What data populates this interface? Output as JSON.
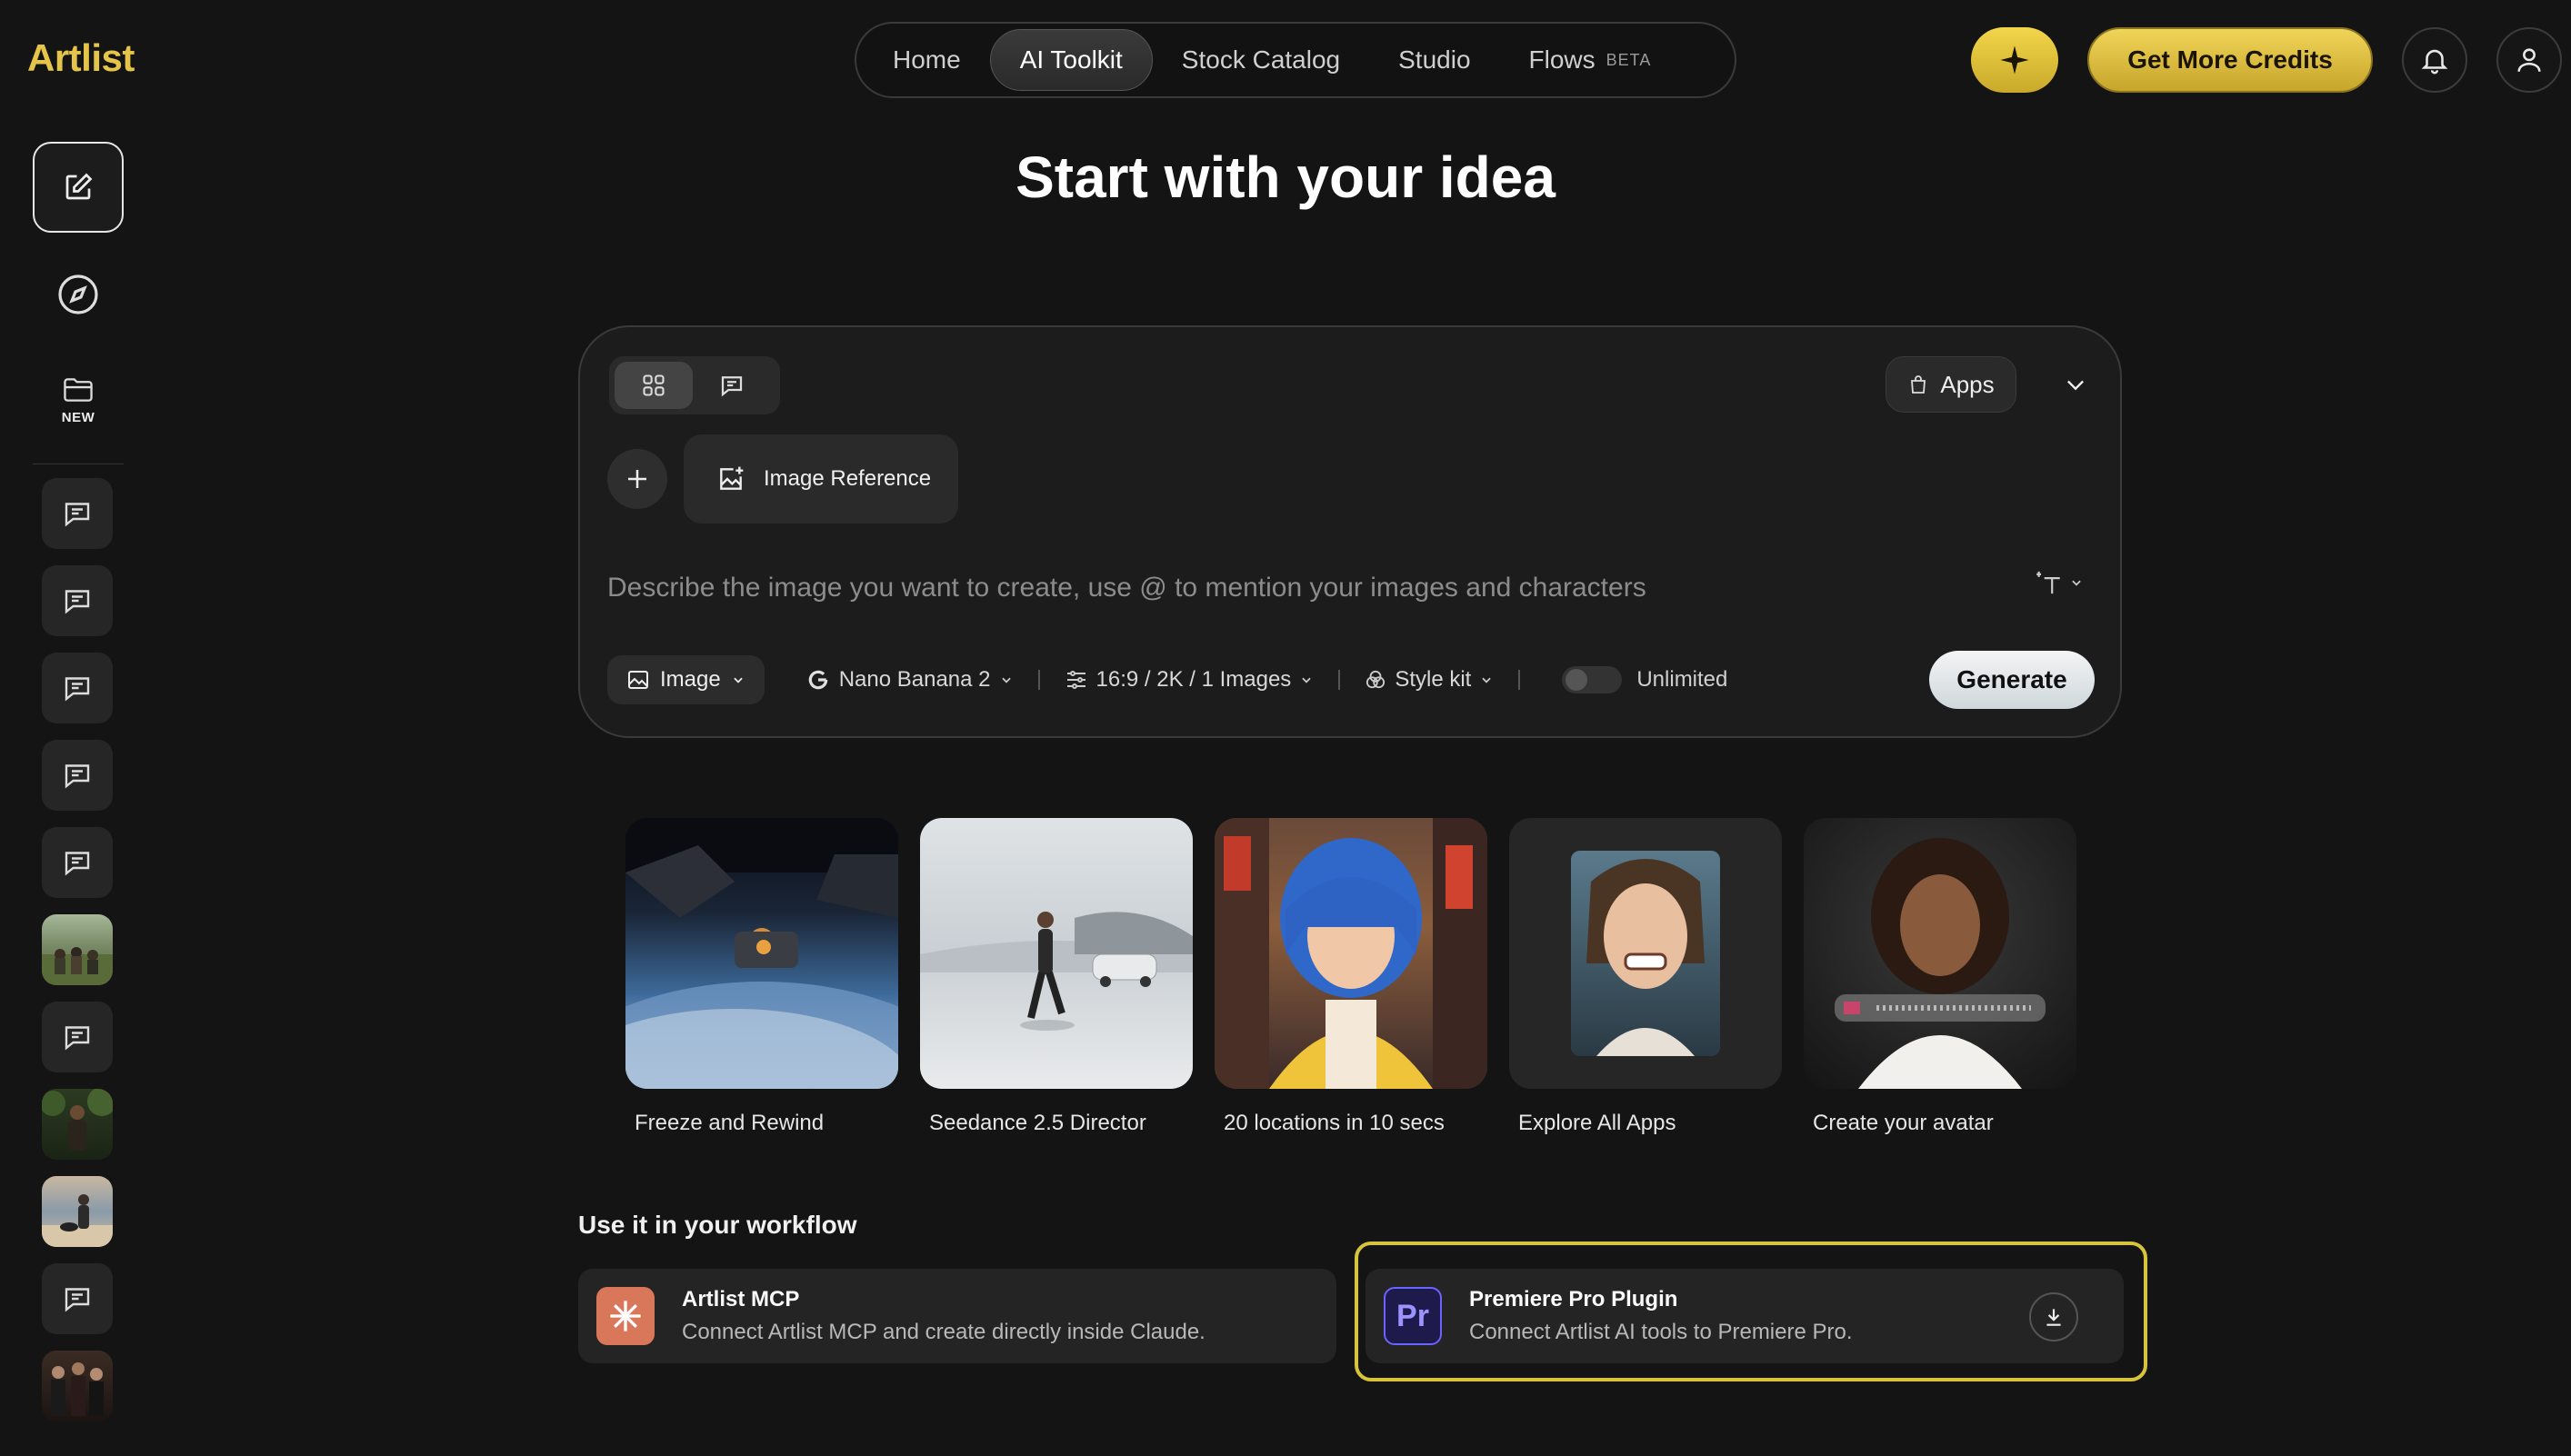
{
  "brand": {
    "logo_text": "Artlist"
  },
  "nav": {
    "items": [
      {
        "label": "Home"
      },
      {
        "label": "AI Toolkit",
        "active": true
      },
      {
        "label": "Stock Catalog"
      },
      {
        "label": "Studio"
      },
      {
        "label": "Flows",
        "badge": "BETA"
      }
    ]
  },
  "header": {
    "spark_icon": "sparkle-icon",
    "credits_label": "Get More Credits",
    "notifications_icon": "bell-icon",
    "account_icon": "user-icon"
  },
  "sidebar": {
    "new_icon": "edit-icon",
    "explore_icon": "compass-icon",
    "folder_badge": "NEW",
    "history": [
      {
        "type": "chat",
        "icon": "chat-icon"
      },
      {
        "type": "chat",
        "icon": "chat-icon"
      },
      {
        "type": "chat",
        "icon": "chat-icon"
      },
      {
        "type": "chat",
        "icon": "chat-icon"
      },
      {
        "type": "chat",
        "icon": "chat-icon"
      },
      {
        "type": "image",
        "theme": "field"
      },
      {
        "type": "chat",
        "icon": "chat-icon"
      },
      {
        "type": "image",
        "theme": "jungle"
      },
      {
        "type": "image",
        "theme": "beach"
      },
      {
        "type": "chat",
        "icon": "chat-icon"
      },
      {
        "type": "image",
        "theme": "group"
      }
    ]
  },
  "hero": {
    "title": "Start with your idea"
  },
  "composer": {
    "apps_label": "Apps",
    "image_reference_label": "Image Reference",
    "prompt_placeholder": "Describe the image you want to create, use @ to mention your images and characters",
    "prompt_value": "",
    "media_type": "Image",
    "model": "Nano Banana 2",
    "settings": "16:9 / 2K / 1 Images",
    "style_kit": "Style kit",
    "unlimited_label": "Unlimited",
    "unlimited_on": false,
    "generate_label": "Generate"
  },
  "cards": [
    {
      "label": "Freeze and Rewind"
    },
    {
      "label": "Seedance 2.5 Director"
    },
    {
      "label": "20 locations in 10 secs"
    },
    {
      "label": "Explore All Apps"
    },
    {
      "label": "Create your avatar"
    }
  ],
  "workflow": {
    "title": "Use it in your workflow",
    "items": [
      {
        "name": "Artlist MCP",
        "desc": "Connect Artlist MCP and create directly inside Claude.",
        "icon_color": "#d9775a"
      },
      {
        "name": "Premiere Pro Plugin",
        "desc": "Connect Artlist AI tools to Premiere Pro.",
        "icon_text": "Pr",
        "icon_color": "#1e1a4c",
        "highlight_color": "#d8c43a"
      }
    ]
  }
}
